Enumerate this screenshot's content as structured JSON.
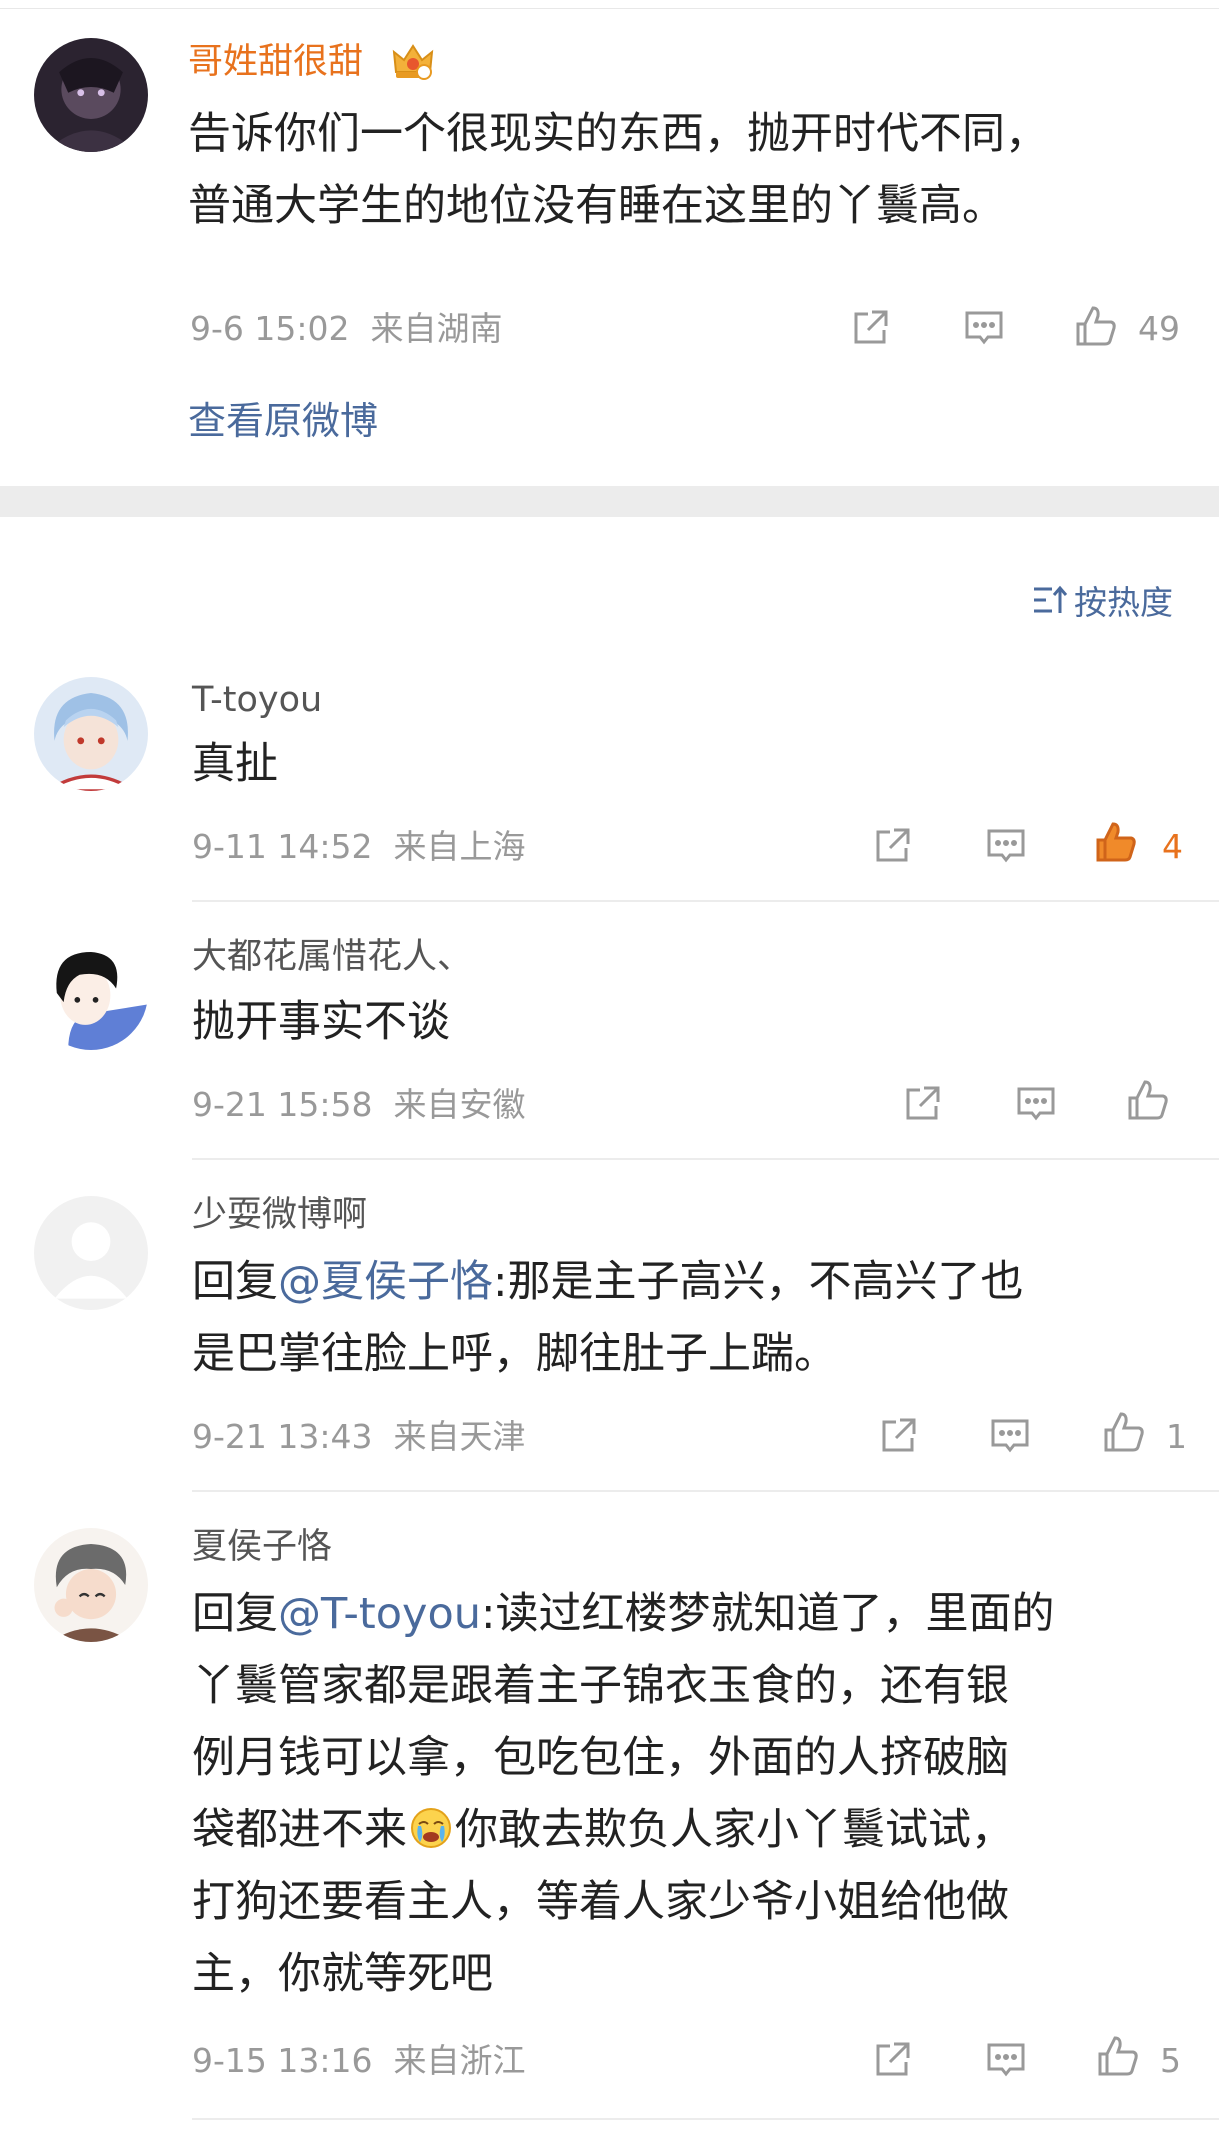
{
  "post": {
    "username": "哥姓甜很甜",
    "lines": [
      "告诉你们一个很现实的东西，抛开时代不同，",
      "普通大学生的地位没有睡在这里的丫鬟高。"
    ],
    "time": "9-6 15:02",
    "location": "来自湖南",
    "likes": "49",
    "view_original": "查看原微博"
  },
  "sort_label": "按热度",
  "comments": [
    {
      "username": "T-toyou",
      "text": "真扯",
      "time": "9-11 14:52",
      "location": "来自上海",
      "likes": "4"
    },
    {
      "username": "大都花属惜花人、",
      "text": "抛开事实不谈",
      "time": "9-21 15:58",
      "location": "来自安徽",
      "likes": ""
    },
    {
      "username": "少耍微博啊",
      "reply_prefix": "回复",
      "mention": "@夏侯子恪",
      "line1_rest": ":那是主子高兴，不高兴了也",
      "line2": "是巴掌往脸上呼，脚往肚子上踹。",
      "time": "9-21 13:43",
      "location": "来自天津",
      "likes": "1"
    },
    {
      "username": "夏侯子恪",
      "reply_prefix": "回复",
      "mention": "@T-toyou",
      "line1_rest": ":读过红楼梦就知道了，里面的",
      "line2": "丫鬟管家都是跟着主子锦衣玉食的，还有银",
      "line3": "例月钱可以拿，包吃包住，外面的人挤破脑",
      "line4a": "袋都进不来",
      "line4b": "你敢去欺负人家小丫鬟试试，",
      "line5": "打狗还要看主人，等着人家少爷小姐给他做",
      "line6": "主，你就等死吧",
      "time": "9-15 13:16",
      "location": "来自浙江",
      "likes": "5"
    }
  ],
  "colors": {
    "accent_link": "#4a6a9c",
    "liked": "#e8721d",
    "meta": "#999999"
  }
}
